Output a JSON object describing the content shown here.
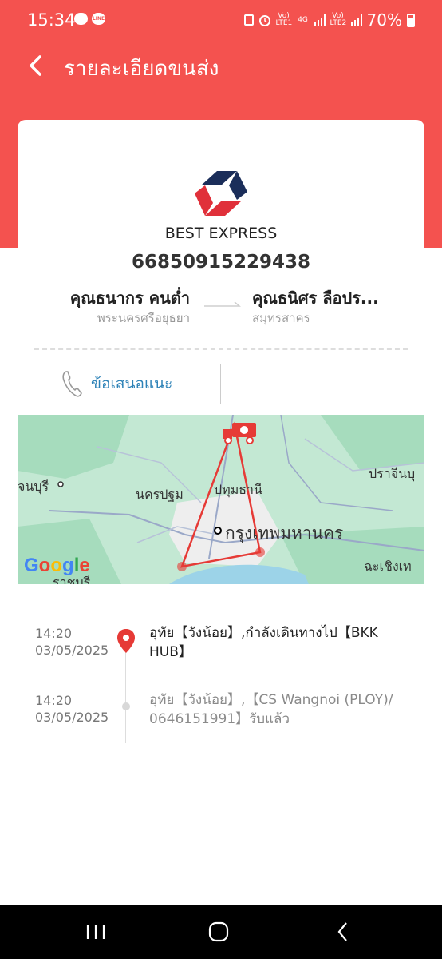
{
  "status_bar": {
    "time": "15:34",
    "battery": "70%",
    "sim1": "Vo) LTE1",
    "network": "4G",
    "sim2": "Vo) LTE2",
    "notification_icons": [
      "chat-bubble-icon",
      "line-app-icon"
    ],
    "system_icons": [
      "nfc-icon",
      "alarm-icon",
      "signal-icon",
      "battery-icon"
    ]
  },
  "header": {
    "back_icon": "chevron-left-icon",
    "title": "รายละเอียดขนส่ง"
  },
  "shipment": {
    "logo": "best-express-logo",
    "company": "BEST EXPRESS",
    "tracking_number": "66850915229438",
    "sender": {
      "name": "คุณธนากร คนต่ำ",
      "location": "พระนครศรีอยุธยา"
    },
    "receiver": {
      "name": "คุณธนิศร ลือปร...",
      "location": "สมุทรสาคร"
    }
  },
  "actions": {
    "advice_icon": "phone-icon",
    "advice_label": "ข้อเสนอแนะ"
  },
  "map": {
    "labels": {
      "lbl1": "จนบุรี",
      "lbl2": "ปราจีนบุ",
      "lbl3": "นครปฐม",
      "lbl4": "ปทุมธานี",
      "lbl5": "กรุงเทพมหานคร",
      "lbl6": "ฉะเชิงเท",
      "lbl7": "ราชบุรี"
    },
    "attribution": "Google",
    "truck_icon": "delivery-truck-icon"
  },
  "timeline": [
    {
      "time": "14:20",
      "date": "03/05/2025",
      "description": "อุทัย【วังน้อย】,กำลังเดินทางไป【BKK HUB】",
      "status": "current",
      "color": "#222222"
    },
    {
      "time": "14:20",
      "date": "03/05/2025",
      "description": "อุทัย【วังน้อย】,【CS Wangnoi (PLOY)/ 0646151991】รับแล้ว",
      "status": "past",
      "color": "#8a8a8a"
    }
  ],
  "navbar": {
    "recent_icon": "recent-apps-icon",
    "home_icon": "home-icon",
    "back_icon": "back-icon"
  },
  "colors": {
    "brand": "#f4524f",
    "link": "#2d82b7",
    "route": "#e63a36"
  }
}
